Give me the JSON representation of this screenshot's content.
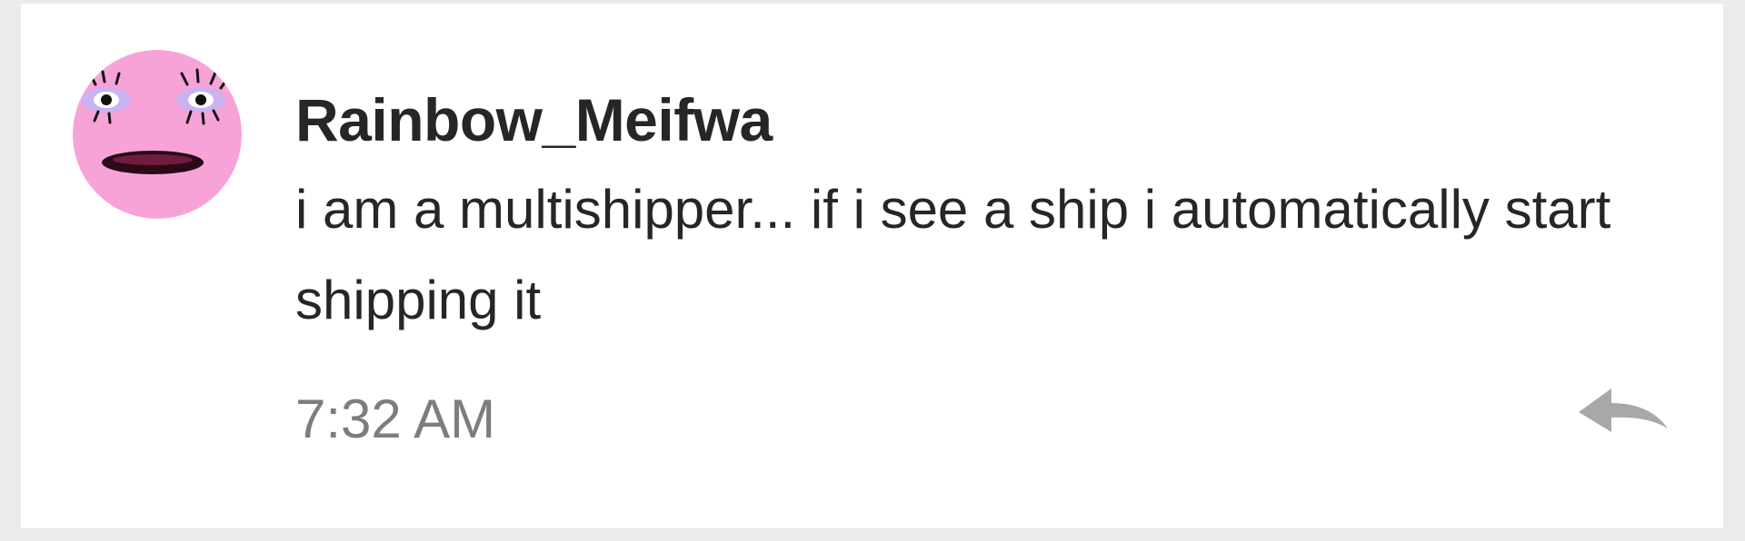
{
  "comment": {
    "username": "Rainbow_Meifwa",
    "message": "i am a multishipper... if i see a ship i automatically start shipping it",
    "timestamp": "7:32 AM",
    "avatar_icon": "pink-face-avatar-icon",
    "reply_icon": "reply-arrow-icon"
  },
  "colors": {
    "background": "#ebebeb",
    "card": "#ffffff",
    "text": "#262626",
    "muted": "#7d7d7d",
    "avatar_pink": "#f7a3d8",
    "reply_icon": "#a8a8a8"
  }
}
